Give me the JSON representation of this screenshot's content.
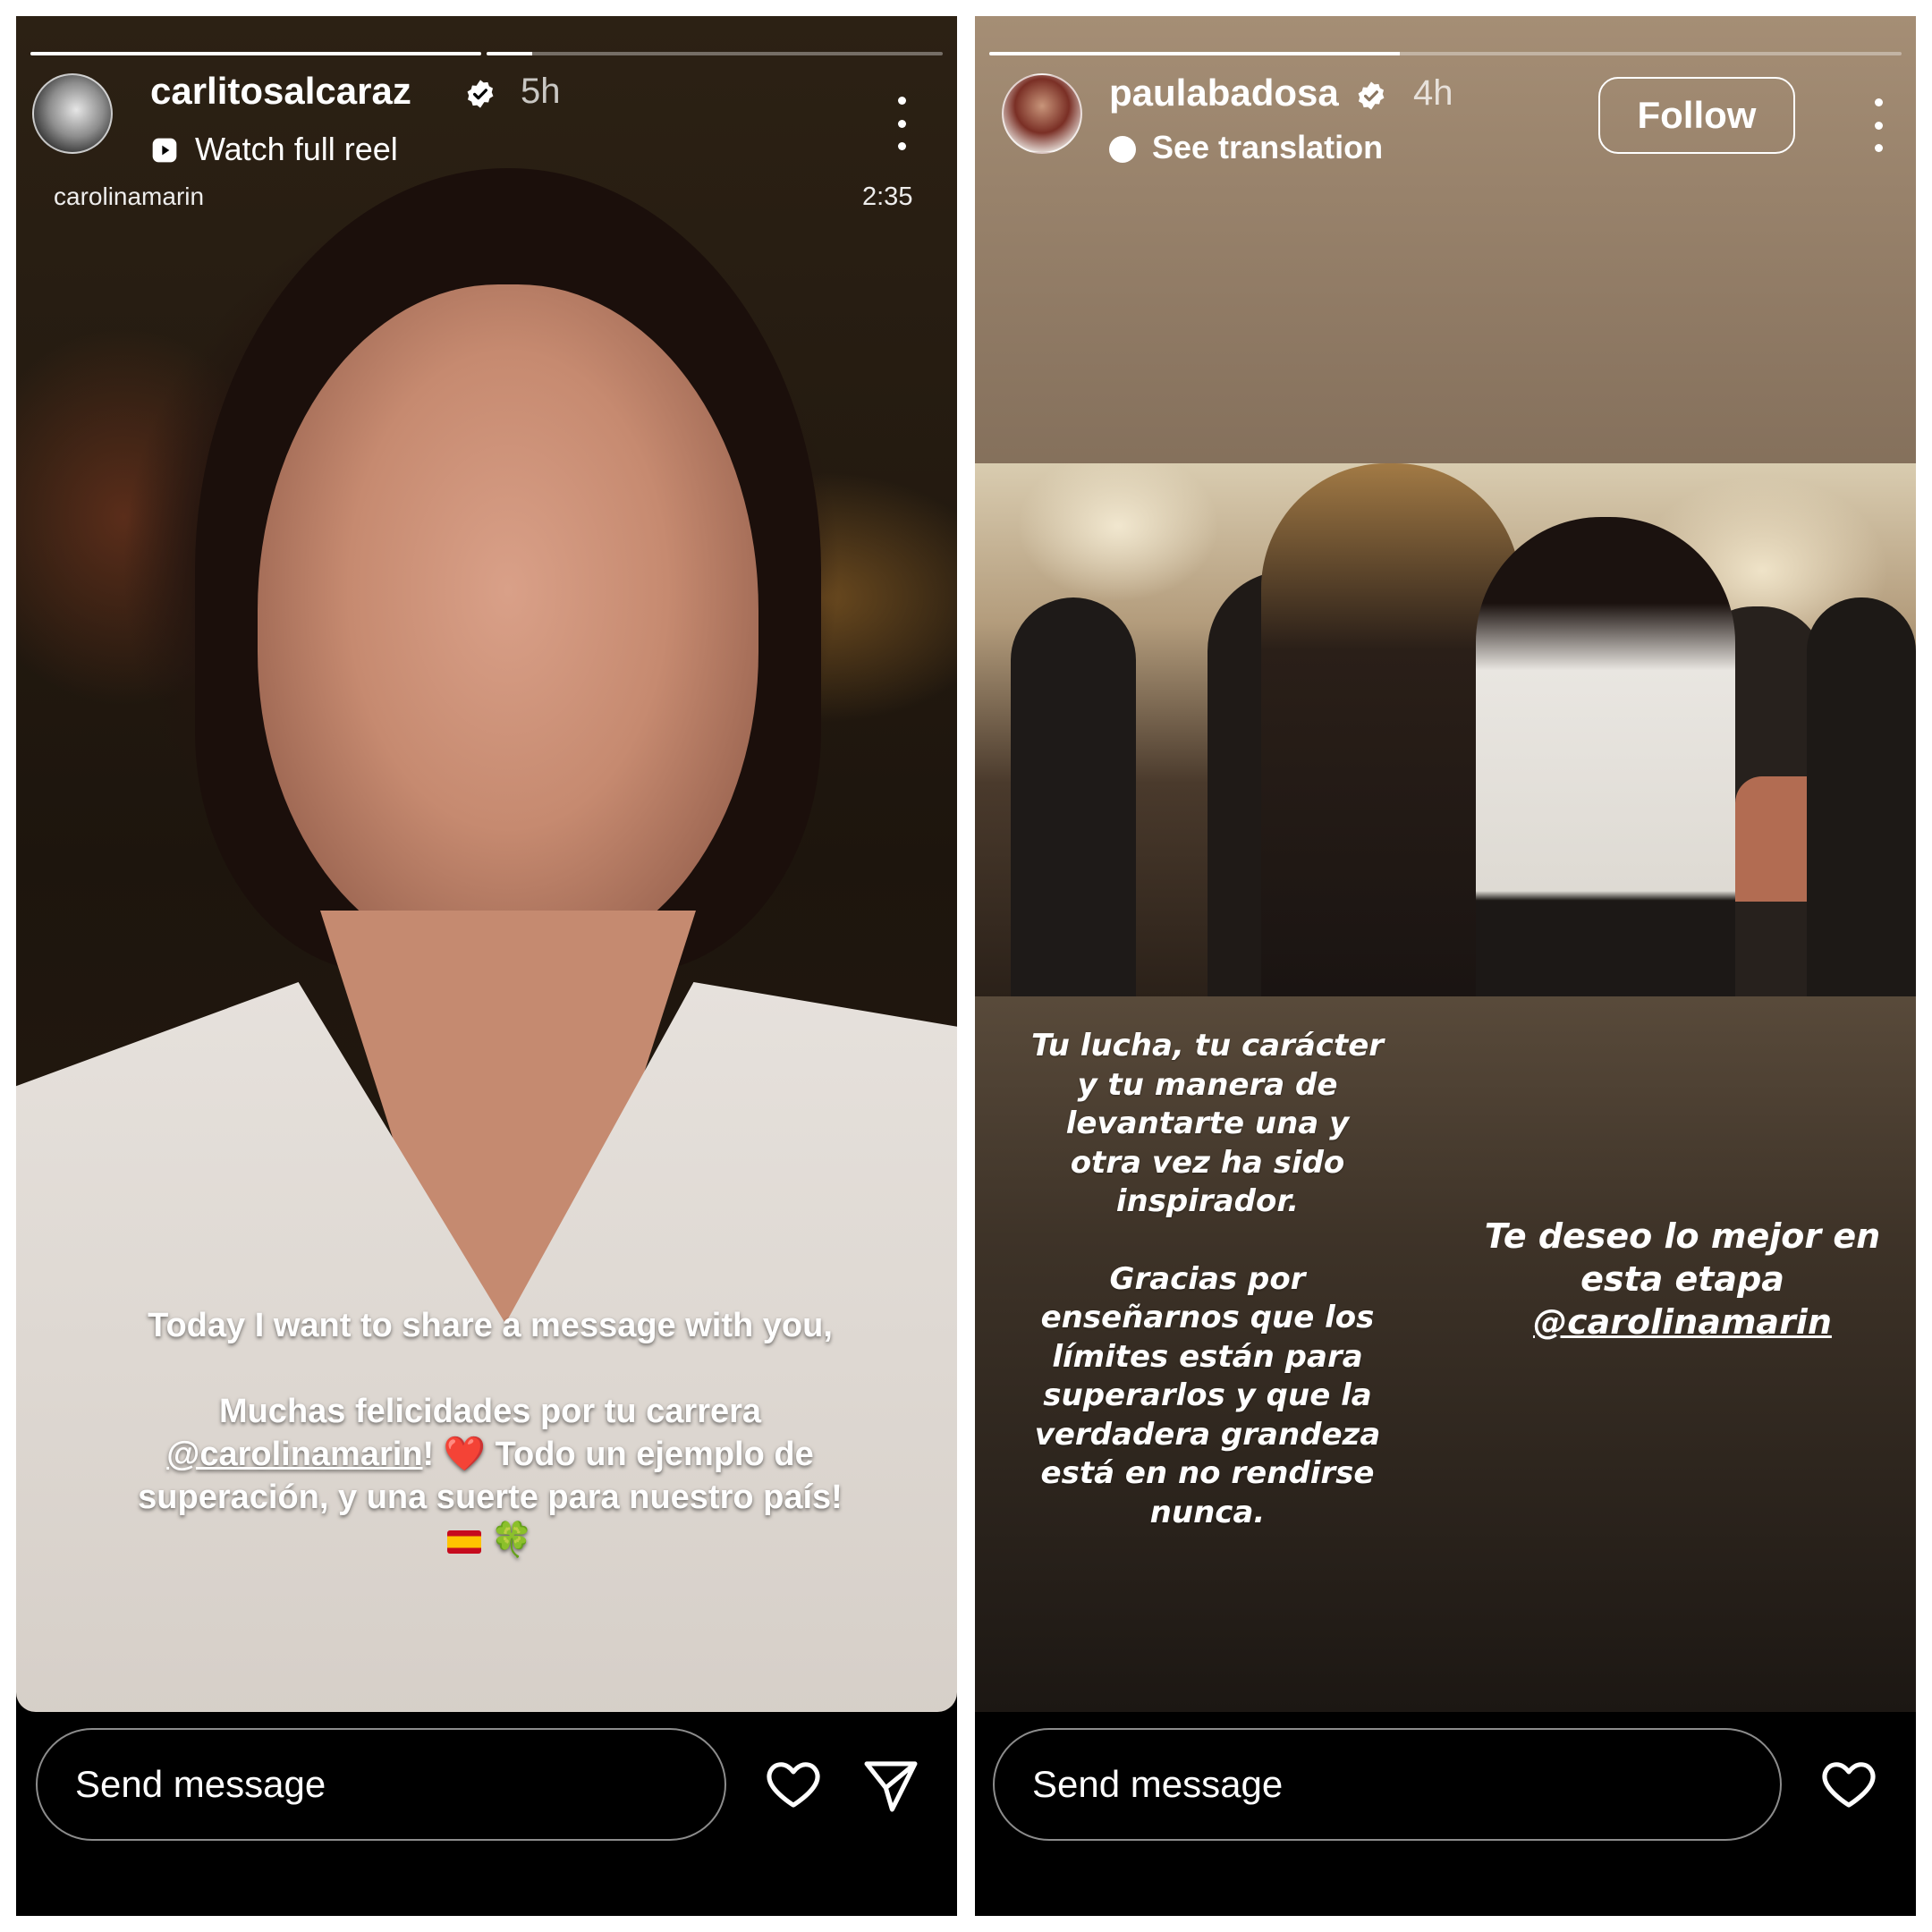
{
  "left_story": {
    "progress": [
      {
        "fill": 1.0
      },
      {
        "fill": 0.1
      }
    ],
    "username": "carlitosalcaraz",
    "time": "5h",
    "watch_label": "Watch full reel",
    "source_username": "carolinamarin",
    "duration": "2:35",
    "caption": {
      "line1": "Today I want to share a message with you,",
      "line2a": "Muchas felicidades por tu carrera",
      "mention": "@carolinamarin",
      "after_mention": "!",
      "heart": "❤️",
      "line3": "Todo un ejemplo de superación, y una suerte para nuestro país!",
      "flag": "🇪🇸",
      "clover": "🍀"
    },
    "message_placeholder": "Send message"
  },
  "right_story": {
    "progress": [
      {
        "fill": 0.45
      }
    ],
    "username": "paulabadosa",
    "time": "4h",
    "translation_label": "See translation",
    "follow_label": "Follow",
    "text_mid_1": "Tu lucha, tu carácter y tu manera de levantarte una y otra vez ha sido inspirador.",
    "text_mid_2": "Gracias por enseñarnos que los límites están para superarlos y que la verdadera grandeza está en no rendirse nunca.",
    "text_right": "Te deseo lo mejor en esta etapa",
    "text_right_mention": "@carolinamarin",
    "message_placeholder": "Send message"
  },
  "icons": {
    "verified": "verified-badge-icon",
    "more": "more-options-icon",
    "heart": "heart-icon",
    "share": "send-icon",
    "reel": "reel-play-icon",
    "translate": "translate-icon"
  },
  "colors": {
    "verified_blue": "#ffffff",
    "story_background": "#000000",
    "heart_emoji": "#e0202a"
  }
}
